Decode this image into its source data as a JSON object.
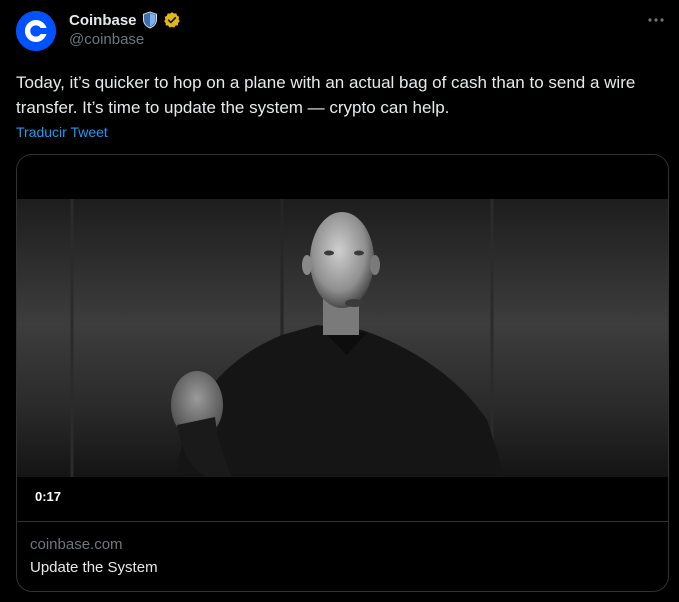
{
  "author": {
    "display_name": "Coinbase",
    "handle": "@coinbase",
    "avatar_icon": "coinbase-logo-icon",
    "brand_color": "#0052ff",
    "badges": [
      "shield-icon",
      "verified-gold-icon"
    ]
  },
  "tweet": {
    "text": "Today, it’s quicker to hop on a plane with an actual bag of cash than to send a wire transfer. It’s time to update the system — crypto can help.",
    "translate_label": "Traducir Tweet",
    "more_icon": "ellipsis-icon"
  },
  "card": {
    "video_duration": "0:17",
    "domain": "coinbase.com",
    "title": "Update the System"
  },
  "colors": {
    "background": "#000000",
    "text": "#e7e9ea",
    "muted": "#71767b",
    "link": "#1d9bf0",
    "border": "#2f3336"
  }
}
